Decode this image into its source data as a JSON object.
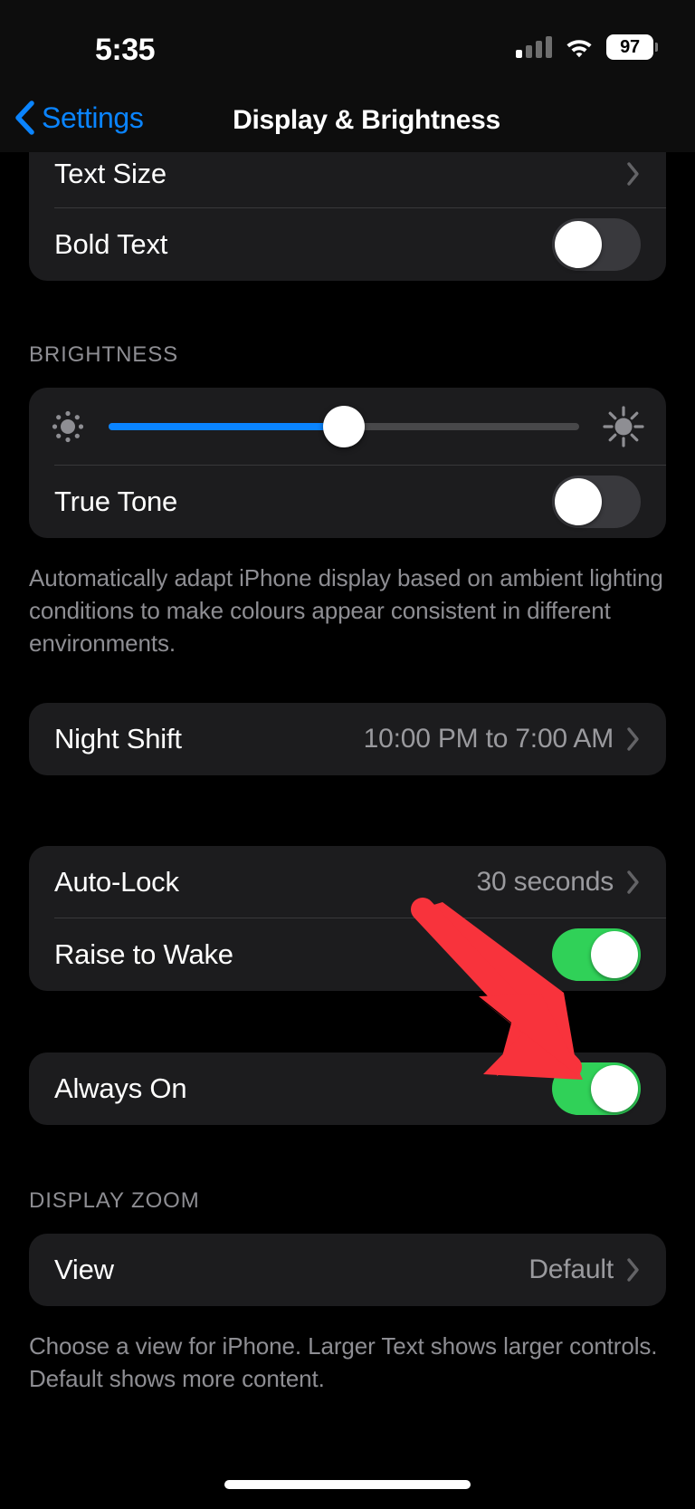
{
  "status_bar": {
    "time": "5:35",
    "battery_percent": "97",
    "signal_icon": "cellular-signal-icon",
    "wifi_icon": "wifi-icon",
    "battery_icon": "battery-icon"
  },
  "nav": {
    "back_label": "Settings",
    "back_icon": "chevron-left-icon",
    "title": "Display & Brightness"
  },
  "colors": {
    "accent_blue": "#0a84ff",
    "toggle_on_green": "#30d158",
    "toggle_off_gray": "#39393d",
    "card_bg": "#1c1c1e",
    "page_bg": "#000000",
    "secondary_text": "#8e8e93",
    "annotation_red": "#f8333c"
  },
  "text_section": {
    "rows": [
      {
        "label": "Text Size",
        "type": "disclosure",
        "value": "",
        "chevron": "chevron-right-icon"
      },
      {
        "label": "Bold Text",
        "type": "toggle",
        "on": false
      }
    ]
  },
  "brightness_section": {
    "header": "BRIGHTNESS",
    "slider": {
      "name": "brightness-slider",
      "value_percent": 50,
      "min_icon": "sun-small-icon",
      "max_icon": "sun-large-icon"
    },
    "true_tone": {
      "label": "True Tone",
      "on": false
    },
    "footer": "Automatically adapt iPhone display based on ambient lighting conditions to make colours appear consistent in different environments."
  },
  "night_shift_section": {
    "rows": [
      {
        "label": "Night Shift",
        "value": "10:00 PM to 7:00 AM",
        "chevron": "chevron-right-icon"
      }
    ]
  },
  "lock_section": {
    "rows": [
      {
        "label": "Auto-Lock",
        "value": "30 seconds",
        "type": "disclosure",
        "chevron": "chevron-right-icon"
      },
      {
        "label": "Raise to Wake",
        "type": "toggle",
        "on": true
      }
    ]
  },
  "always_on_section": {
    "rows": [
      {
        "label": "Always On",
        "type": "toggle",
        "on": true
      }
    ]
  },
  "display_zoom_section": {
    "header": "DISPLAY ZOOM",
    "rows": [
      {
        "label": "View",
        "value": "Default",
        "chevron": "chevron-right-icon"
      }
    ],
    "footer": "Choose a view for iPhone. Larger Text shows larger controls. Default shows more content."
  },
  "annotation": {
    "type": "arrow",
    "name": "red-annotation-arrow",
    "points_to": "always-on-toggle",
    "color": "#f8333c"
  }
}
